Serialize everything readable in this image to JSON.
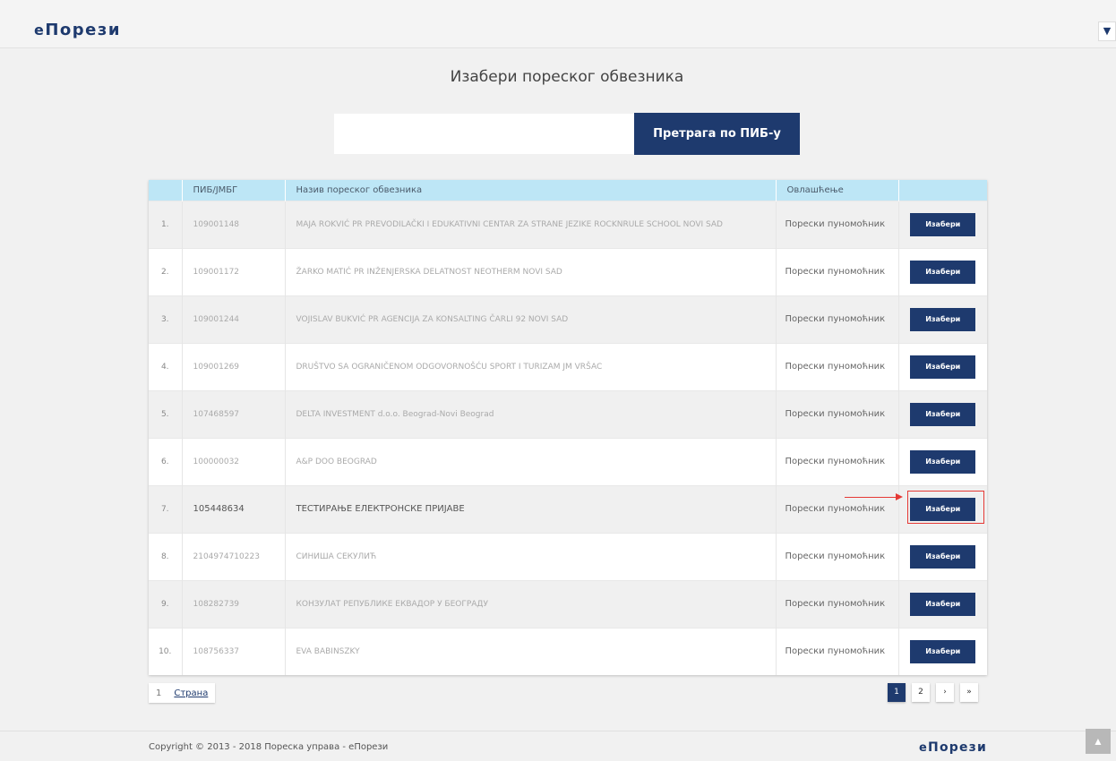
{
  "header": {
    "logo_small": "е",
    "logo_rest": "Порези",
    "toggle_icon": "chevron-down"
  },
  "page": {
    "title": "Изабери пореског обвезника"
  },
  "search": {
    "value": "",
    "placeholder": "",
    "button_label": "Претрага по ПИБ-у"
  },
  "table": {
    "columns": [
      "",
      "ПИБ/ЈМБГ",
      "Назив пореског обвезника",
      "Овлашћење",
      ""
    ],
    "rows": [
      {
        "num": "1.",
        "pib": "109001148",
        "name": "MAJA ROKVIĆ PR PREVODILAČKI I EDUKATIVNI CENTAR ZA STRANE JEZIKE ROCKNRULE SCHOOL NOVI SAD",
        "auth": "Порески пуномоћник",
        "action": "Изабери"
      },
      {
        "num": "2.",
        "pib": "109001172",
        "name": "ŽARKO MATIĆ PR INŽENJERSKA DELATNOST NEOTHERM NOVI SAD",
        "auth": "Порески пуномоћник",
        "action": "Изабери"
      },
      {
        "num": "3.",
        "pib": "109001244",
        "name": "VOJISLAV BUKVIĆ PR AGENCIJA ZA KONSALTING ČARLI 92 NOVI SAD",
        "auth": "Порески пуномоћник",
        "action": "Изабери"
      },
      {
        "num": "4.",
        "pib": "109001269",
        "name": "DRUŠTVO SA OGRANIČENOM ODGOVORNOŠĆU SPORT I TURIZAM JM VRŠAC",
        "auth": "Порески пуномоћник",
        "action": "Изабери"
      },
      {
        "num": "5.",
        "pib": "107468597",
        "name": "DELTA INVESTMENT d.o.o. Beograd-Novi Beograd",
        "auth": "Порески пуномоћник",
        "action": "Изабери"
      },
      {
        "num": "6.",
        "pib": "100000032",
        "name": "A&P DOO BEOGRAD",
        "auth": "Порески пуномоћник",
        "action": "Изабери"
      },
      {
        "num": "7.",
        "pib": "105448634",
        "name": "ТЕСТИРАЊЕ ЕЛЕКТРОНСКЕ ПРИЈАВЕ",
        "auth": "Порески пуномоћник",
        "action": "Изабери"
      },
      {
        "num": "8.",
        "pib": "2104974710223",
        "name": "СИНИША СЕКУЛИЋ",
        "auth": "Порески пуномоћник",
        "action": "Изабери"
      },
      {
        "num": "9.",
        "pib": "108282739",
        "name": "КОНЗУЛАТ РЕПУБЛИКЕ ЕКВАДОР У БЕОГРАДУ",
        "auth": "Порески пуномоћник",
        "action": "Изабери"
      },
      {
        "num": "10.",
        "pib": "108756337",
        "name": "EVA BABINSZKY",
        "auth": "Порески пуномоћник",
        "action": "Изабери"
      }
    ]
  },
  "pagination": {
    "page_input": "1",
    "page_label": "Страна",
    "pages": [
      "1",
      "2"
    ],
    "current": "1",
    "next": "›",
    "last": "»"
  },
  "footer": {
    "copyright": "Copyright © 2013 - 2018 Пореска управа - еПорези",
    "logo_small": "е",
    "logo_rest": "Порези"
  },
  "colors": {
    "brand": "#1e3a6e",
    "header_row": "#bde6f6",
    "highlight": "#e53935"
  }
}
